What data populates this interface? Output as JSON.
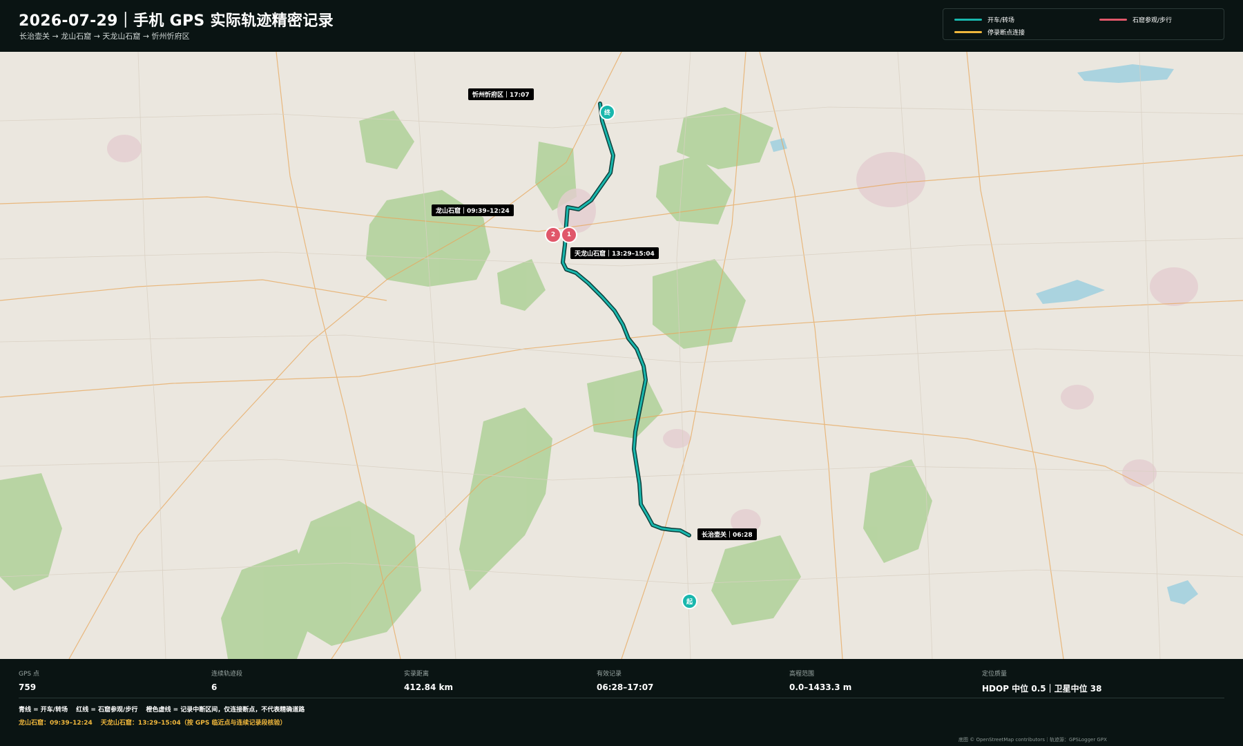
{
  "header": {
    "title": "2026-07-29｜手机 GPS 实际轨迹精密记录",
    "subtitle": "长治壶关 → 龙山石窟 → 天龙山石窟 → 忻州忻府区"
  },
  "legend": {
    "items": [
      {
        "label": "开车/转场",
        "color": "#19b7ad"
      },
      {
        "label": "石窟参观/步行",
        "color": "#e0576a"
      },
      {
        "label": "停录断点连接",
        "color": "#f0b73c"
      }
    ]
  },
  "map": {
    "labels": {
      "xinzhou": "忻州忻府区｜17:07",
      "longshan": "龙山石窟｜09:39–12:24",
      "tianlongshan": "天龙山石窟｜13:29–15:04",
      "changzhi": "长治壶关｜06:28"
    },
    "markers": {
      "end": "终",
      "start": "起",
      "site1": "1",
      "site2": "2"
    },
    "colors": {
      "route": "#19b7ad",
      "route_outline": "#0d3f3b",
      "site": "#e0576a",
      "background": "#ebe7df",
      "forest": "#b2d29c"
    }
  },
  "stats": {
    "gps_points": {
      "label": "GPS 点",
      "value": "759"
    },
    "segments": {
      "label": "连续轨迹段",
      "value": "6"
    },
    "distance": {
      "label": "实录距离",
      "value": "412.84 km"
    },
    "time": {
      "label": "有效记录",
      "value": "06:28–17:07"
    },
    "elevation": {
      "label": "高程范围",
      "value": "0.0–1433.3 m"
    },
    "quality": {
      "label": "定位质量",
      "value": "HDOP 中位 0.5｜卫星中位 38"
    }
  },
  "notes": {
    "line1": "青线 = 开车/转场　 红线 = 石窟参观/步行　 橙色虚线 = 记录中断区间，仅连接断点，不代表精确道路",
    "line2": "龙山石窟：09:39–12:24　 天龙山石窟：13:29–15:04（按 GPS 临近点与连续记录段核验）"
  },
  "attribution": "底图 © OpenStreetMap contributors｜轨迹源：GPSLogger GPX"
}
